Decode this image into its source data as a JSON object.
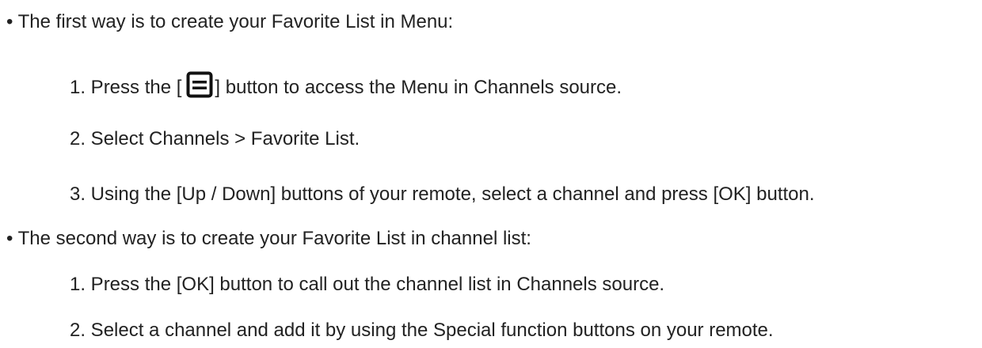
{
  "section1": {
    "bullet": "•",
    "heading": "The first way is to create your Favorite List in Menu:",
    "steps": [
      {
        "prefix": "1. Press the [",
        "suffix": "] button to access the Menu in Channels source."
      },
      {
        "text": "2. Select Channels > Favorite List."
      },
      {
        "text": "3. Using the [Up / Down] buttons of your remote, select a channel and press [OK] button."
      }
    ],
    "icon": "menu-icon"
  },
  "section2": {
    "bullet": "•",
    "heading": "The second way is to create your Favorite List in channel list:",
    "steps": [
      {
        "text": "1. Press the [OK] button to call out the channel list in Channels source."
      },
      {
        "text": "2. Select a channel and add it by using the Special function buttons on your remote."
      }
    ]
  }
}
